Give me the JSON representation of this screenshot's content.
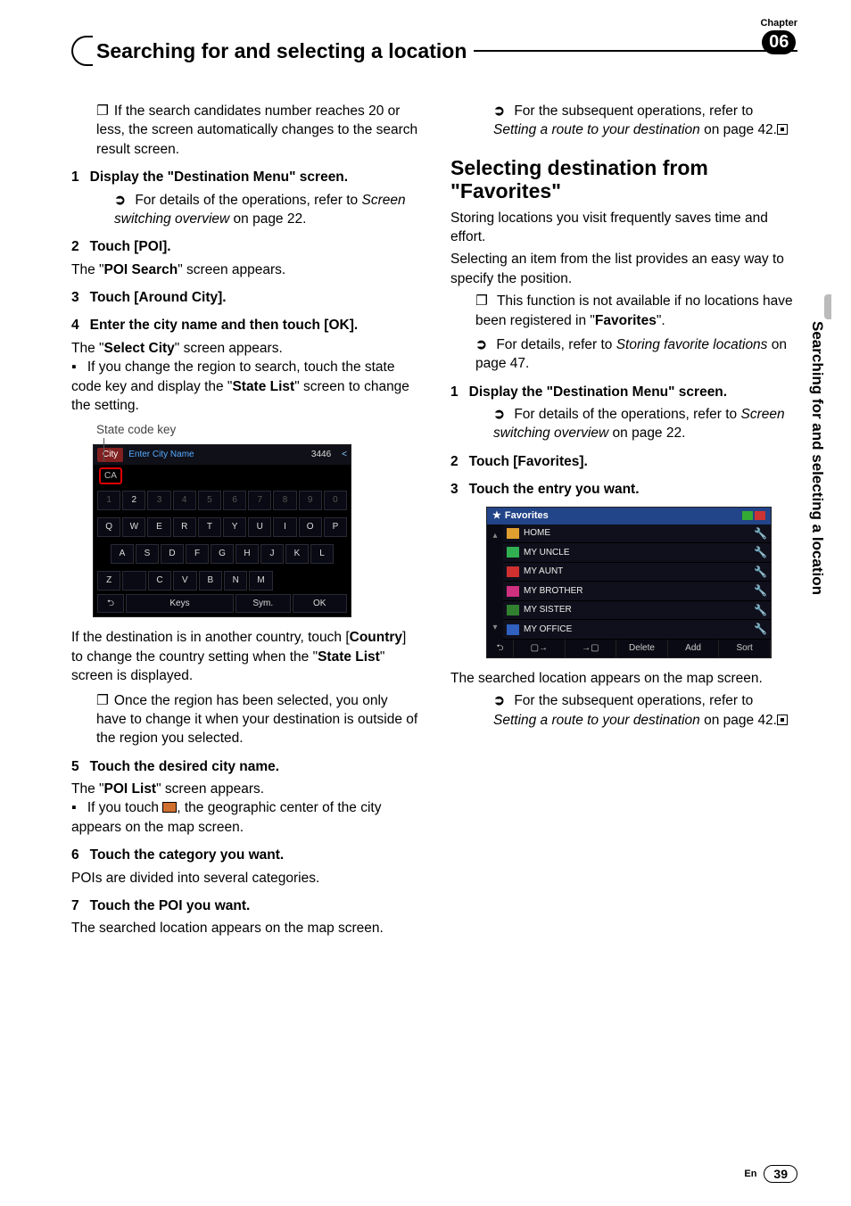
{
  "header": {
    "title": "Searching for and selecting a location",
    "chapter_label": "Chapter",
    "chapter_num": "06"
  },
  "side_tab": "Searching for and selecting a location",
  "footer": {
    "lang": "En",
    "page": "39"
  },
  "col_left": {
    "note1": "If the search candidates number reaches 20 or less, the screen automatically changes to the search result screen.",
    "step1": {
      "num": "1",
      "text": "Display the \"Destination Menu\" screen."
    },
    "step1_ref_a": "For details of the operations, refer to ",
    "step1_ref_i": "Screen switching overview",
    "step1_ref_b": " on page 22.",
    "step2": {
      "num": "2",
      "text": "Touch [POI]."
    },
    "step2_body_a": "The \"",
    "step2_body_b": "POI Search",
    "step2_body_c": "\" screen appears.",
    "step3": {
      "num": "3",
      "text": "Touch [Around City]."
    },
    "step4": {
      "num": "4",
      "text": "Enter the city name and then touch [OK]."
    },
    "step4_body_a": "The \"",
    "step4_body_b": "Select City",
    "step4_body_c": "\" screen appears.",
    "step4_bullet_a": "If you change the region to search, touch the state code key and display the \"",
    "step4_bullet_b": "State List",
    "step4_bullet_c": "\" screen to change the setting.",
    "state_code_caption": "State code key",
    "after_img_a": "If the destination is in another country, touch [",
    "after_img_b": "Country",
    "after_img_c": "] to change the country setting when the \"",
    "after_img_d": "State List",
    "after_img_e": "\" screen is displayed.",
    "after_note": "Once the region has been selected, you only have to change it when your destination is outside of the region you selected.",
    "step5": {
      "num": "5",
      "text": "Touch the desired city name."
    },
    "step5_body_a": "The \"",
    "step5_body_b": "POI List",
    "step5_body_c": "\" screen appears.",
    "step5_bullet_a": "If you touch ",
    "step5_bullet_b": ", the geographic center of the city appears on the map screen.",
    "step6": {
      "num": "6",
      "text": "Touch the category you want."
    },
    "step6_body": "POIs are divided into several categories.",
    "step7": {
      "num": "7",
      "text": "Touch the POI you want."
    },
    "step7_body": "The searched location appears on the map screen."
  },
  "col_right": {
    "top_ref_a": "For the subsequent operations, refer to ",
    "top_ref_i": "Setting a route to your destination",
    "top_ref_b": " on page 42.",
    "section_head": "Selecting destination from \"Favorites\"",
    "intro1": "Storing locations you visit frequently saves time and effort.",
    "intro2": "Selecting an item from the list provides an easy way to specify the position.",
    "note_sq_a": "This function is not available if no locations have been registered in \"",
    "note_sq_b": "Favorites",
    "note_sq_c": "\".",
    "note_ar_a": "For details, refer to ",
    "note_ar_i": "Storing favorite locations",
    "note_ar_b": " on page 47.",
    "step1": {
      "num": "1",
      "text": "Display the \"Destination Menu\" screen."
    },
    "step1_ref_a": "For details of the operations, refer to ",
    "step1_ref_i": "Screen switching overview",
    "step1_ref_b": " on page 22.",
    "step2": {
      "num": "2",
      "text": "Touch [Favorites]."
    },
    "step3": {
      "num": "3",
      "text": "Touch the entry you want."
    },
    "after_img": "The searched location appears on the map screen.",
    "bot_ref_a": "For the subsequent operations, refer to ",
    "bot_ref_i": "Setting a route to your destination",
    "bot_ref_b": " on page 42."
  },
  "embed1": {
    "tab": "City",
    "hint": "Enter City Name",
    "count": "3446",
    "arrow": "<",
    "state_key": "CA",
    "row_nums": [
      "1",
      "2",
      "3",
      "4",
      "5",
      "6",
      "7",
      "8",
      "9",
      "0"
    ],
    "row_a": [
      "Q",
      "W",
      "E",
      "R",
      "T",
      "Y",
      "U",
      "I",
      "O",
      "P"
    ],
    "row_b": [
      "A",
      "S",
      "D",
      "F",
      "G",
      "H",
      "J",
      "K",
      "L"
    ],
    "row_c": [
      "Z",
      "",
      "C",
      "V",
      "B",
      "N",
      "M"
    ],
    "bottom": {
      "back": "⮌",
      "keys": "Keys",
      "sym": "Sym.",
      "ok": "OK"
    }
  },
  "embed2": {
    "title": "Favorites",
    "items": [
      {
        "name": "HOME",
        "color": "#e0a030"
      },
      {
        "name": "MY UNCLE",
        "color": "#30b050"
      },
      {
        "name": "MY AUNT",
        "color": "#d03030"
      },
      {
        "name": "MY BROTHER",
        "color": "#d03080"
      },
      {
        "name": "MY SISTER",
        "color": "#308030"
      },
      {
        "name": "MY OFFICE",
        "color": "#3060c0"
      }
    ],
    "tool_glyph": "🔧",
    "scroll_up": "▴",
    "scroll_down": "▾",
    "bottom": {
      "back": "⮌",
      "b1": "▢→",
      "b2": "→▢",
      "delete": "Delete",
      "add": "Add",
      "sort": "Sort"
    }
  }
}
